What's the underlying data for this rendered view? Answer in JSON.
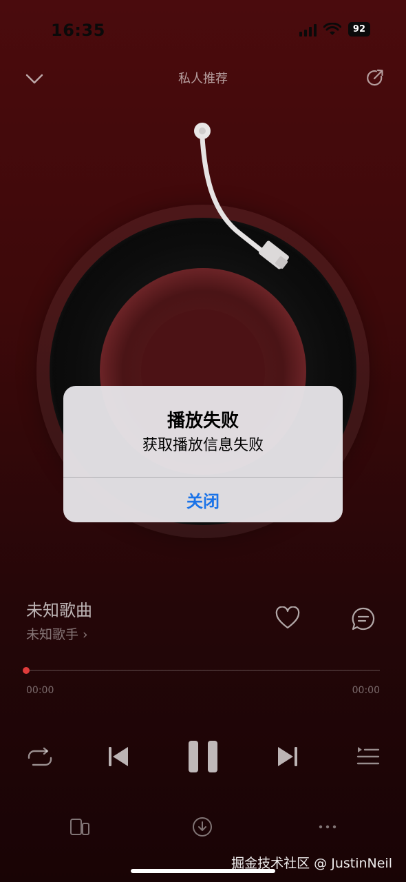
{
  "status_bar": {
    "time": "16:35",
    "battery": "92"
  },
  "nav": {
    "title": "私人推荐"
  },
  "alert": {
    "title": "播放失败",
    "message": "获取播放信息失败",
    "button_label": "关闭"
  },
  "song": {
    "title": "未知歌曲",
    "artist": "未知歌手 ›"
  },
  "progress": {
    "current": "00:00",
    "total": "00:00",
    "fraction": 0
  },
  "watermark": "掘金技术社区 @ JustinNeil",
  "colors": {
    "accent": "#e03b3b",
    "alert_button": "#1a73e8",
    "background": "#4b0b0d"
  }
}
